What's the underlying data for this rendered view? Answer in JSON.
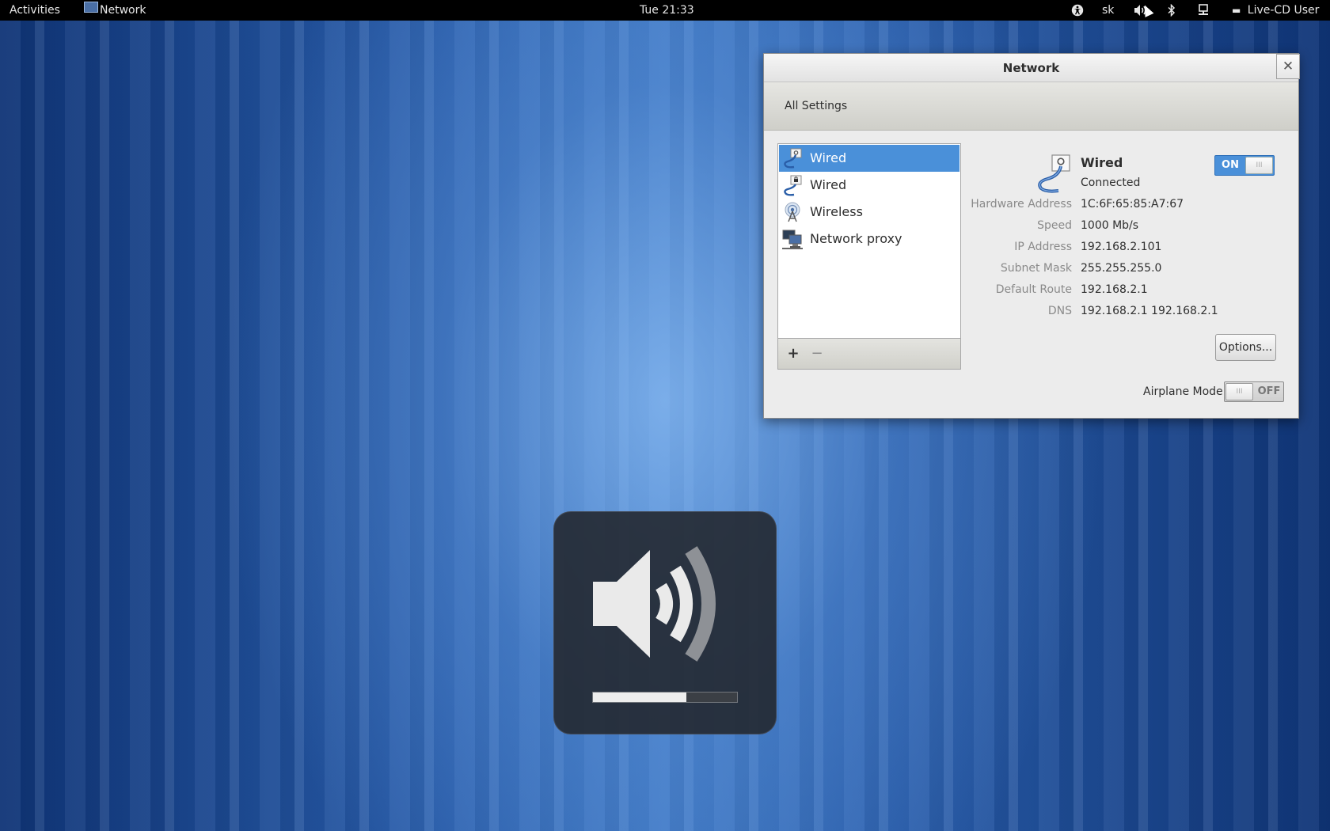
{
  "top_bar": {
    "activities": "Activities",
    "app_menu": "Network",
    "clock": "Tue 21:33",
    "keyboard_layout": "sk",
    "user": "Live-CD User",
    "icons": [
      "accessibility-icon",
      "volume-icon",
      "bluetooth-icon",
      "network-icon",
      "chat-icon"
    ]
  },
  "window": {
    "title": "Network",
    "close_glyph": "✕",
    "toolbar": {
      "all_settings": "All Settings"
    }
  },
  "device_list": {
    "items": [
      {
        "label": "Wired",
        "icon": "wired-network-icon",
        "selected": true
      },
      {
        "label": "Wired",
        "icon": "wired-network-locked-icon",
        "selected": false
      },
      {
        "label": "Wireless",
        "icon": "wireless-icon",
        "selected": false
      },
      {
        "label": "Network proxy",
        "icon": "network-proxy-icon",
        "selected": false
      }
    ],
    "add_label": "+",
    "remove_label": "−"
  },
  "detail": {
    "title": "Wired",
    "status": "Connected",
    "switch_label": "ON",
    "switch_knob": "III",
    "rows": [
      {
        "label": "Hardware Address",
        "value": "1C:6F:65:85:A7:67"
      },
      {
        "label": "Speed",
        "value": "1000 Mb/s"
      },
      {
        "label": "IP Address",
        "value": "192.168.2.101"
      },
      {
        "label": "Subnet Mask",
        "value": "255.255.255.0"
      },
      {
        "label": "Default Route",
        "value": "192.168.2.1"
      },
      {
        "label": "DNS",
        "value": "192.168.2.1 192.168.2.1"
      }
    ],
    "options_label": "Options...",
    "airplane_mode_label": "Airplane Mode",
    "airplane_switch_label": "OFF",
    "airplane_switch_knob": "III"
  },
  "volume_osd": {
    "level": 0.65
  },
  "colors": {
    "selection": "#4a90d9",
    "panel_bg": "#000000",
    "window_bg": "#ececec"
  }
}
